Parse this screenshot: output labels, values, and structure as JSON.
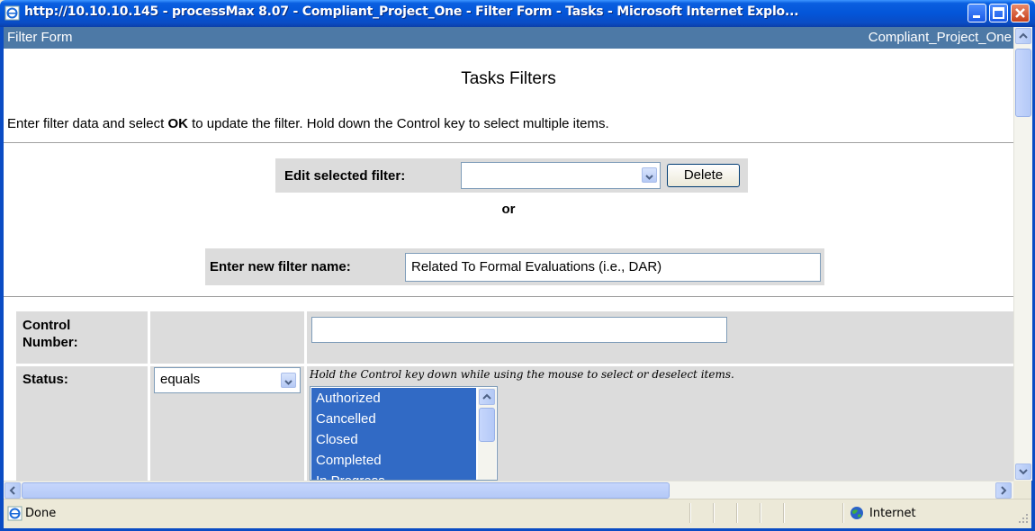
{
  "window": {
    "title": "http://10.10.10.145 - processMax 8.07 - Compliant_Project_One - Filter Form - Tasks - Microsoft Internet Explo..."
  },
  "header": {
    "left": "Filter Form",
    "right": "Compliant_Project_One"
  },
  "page": {
    "heading": "Tasks Filters",
    "instructions": {
      "before": "Enter filter data and select ",
      "bold": "OK",
      "after": " to update the filter. Hold down the Control key to select multiple items."
    }
  },
  "filter_select": {
    "label": "Edit selected filter:",
    "value": "",
    "delete_label": "Delete",
    "or_label": "or",
    "new_label": "Enter new filter name:",
    "new_value": "Related To Formal Evaluations (i.e., DAR)"
  },
  "criteria": {
    "control_number": {
      "label_line1": "Control",
      "label_line2": "Number:",
      "value": ""
    },
    "status": {
      "label": "Status:",
      "operator": "equals",
      "hint": "Hold the Control key down while using the mouse to select or deselect items.",
      "items": [
        "Authorized",
        "Cancelled",
        "Closed",
        "Completed",
        "In Progress"
      ]
    }
  },
  "statusbar": {
    "text": "Done",
    "zone": "Internet"
  },
  "icons": [
    "ie-page-icon",
    "minimize-icon",
    "maximize-icon",
    "close-icon",
    "dropdown-arrow-icon",
    "scroll-up-icon",
    "scroll-down-icon",
    "scroll-left-icon",
    "scroll-right-icon",
    "globe-icon",
    "resize-grip-icon"
  ]
}
